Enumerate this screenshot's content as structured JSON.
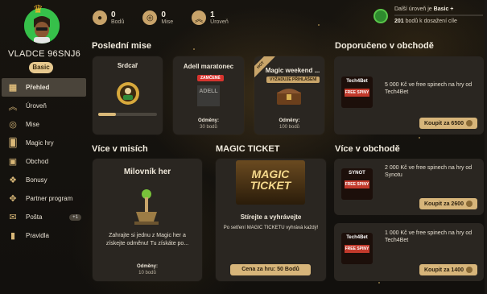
{
  "user": {
    "name": "VLADCE 96SNJ6",
    "level": "Basic"
  },
  "nav": [
    {
      "label": "Přehled",
      "icon": "grid-icon"
    },
    {
      "label": "Úroveň",
      "icon": "chevrons-up-icon"
    },
    {
      "label": "Mise",
      "icon": "target-icon"
    },
    {
      "label": "Magic hry",
      "icon": "cards-icon"
    },
    {
      "label": "Obchod",
      "icon": "bag-icon"
    },
    {
      "label": "Bonusy",
      "icon": "gift-icon"
    },
    {
      "label": "Partner program",
      "icon": "handshake-icon"
    },
    {
      "label": "Pošta",
      "icon": "mail-icon",
      "badge": "+1"
    },
    {
      "label": "Pravidla",
      "icon": "book-icon"
    }
  ],
  "stats": [
    {
      "value": "0",
      "label": "Bodů",
      "icon": "coins-icon"
    },
    {
      "value": "0",
      "label": "Mise",
      "icon": "target-icon"
    },
    {
      "value": "1",
      "label": "Úroveň",
      "icon": "chevrons-up-icon"
    }
  ],
  "next_level": {
    "prefix": "Další úroveň je",
    "level": "Basic +",
    "points": "201",
    "suffix": "bodů k dosažení cíle",
    "progress": 0
  },
  "sections": {
    "missions": "Poslední mise",
    "recommended": "Doporučeno v obchodě",
    "more_missions": "Více v misích",
    "magic_ticket": "MAGIC TICKET",
    "more_shop": "Více v obchodě"
  },
  "missions": [
    {
      "title": "Srdcař",
      "progress": 0.3
    },
    {
      "title": "Adell maratonec",
      "badge": "ZAMČENÉ",
      "reward_label": "Odměny:",
      "reward": "30 bodů",
      "logo": "ADELL"
    },
    {
      "title": "Magic weekend ...",
      "badge": "VYŽADUJE PŘIHLÁŠENÍ",
      "corner": "HOT",
      "reward_label": "Odměny:",
      "reward": "100 bodů"
    }
  ],
  "more_missions_card": {
    "title": "Milovník her",
    "text": "Zahrajte si jednu z Magic her a získejte odměnu! Tu získáte po...",
    "reward_label": "Odměny:",
    "reward": "10 bodů"
  },
  "ticket": {
    "image_text_1": "MAGIC",
    "image_text_2": "TICKET",
    "title": "Stírejte a vyhrávejte",
    "text": "Po setření MAGIC TICKETU vyhrává každý!",
    "button": "Cena za hru: 50 Bodů"
  },
  "shop": [
    {
      "text": "5 000 Kč ve free spinech na hry od Tech4Bet",
      "button": "Koupit za 6500",
      "logo": "Tech4Bet",
      "tag": "FREE SPINY"
    },
    {
      "text": "2 000 Kč ve free spinech na hry od Synotu",
      "button": "Koupit za 2600",
      "logo": "SYNOT",
      "tag": "FREE SPINY"
    },
    {
      "text": "1 000 Kč ve free spinech na hry od Tech4Bet",
      "button": "Koupit za 1400",
      "logo": "Tech4Bet",
      "tag": "FREE SPINY"
    }
  ]
}
